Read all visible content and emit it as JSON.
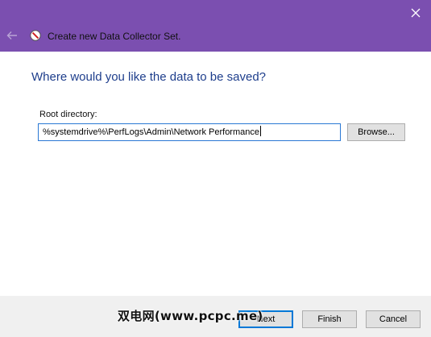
{
  "titlebar": {
    "title": "Create new Data Collector Set.",
    "accent_color": "#7b4fb0",
    "back_icon": "back-arrow-icon",
    "app_icon": "data-collector-icon",
    "close_icon": "close-icon"
  },
  "main": {
    "heading": "Where would you like the data to be saved?",
    "root_directory_label": "Root directory:",
    "root_directory_value": "%systemdrive%\\PerfLogs\\Admin\\Network Performance",
    "browse_label": "Browse..."
  },
  "footer": {
    "next_label": "Next",
    "finish_label": "Finish",
    "cancel_label": "Cancel"
  },
  "watermark": {
    "text": "双电网(www.pcpc.me)"
  }
}
